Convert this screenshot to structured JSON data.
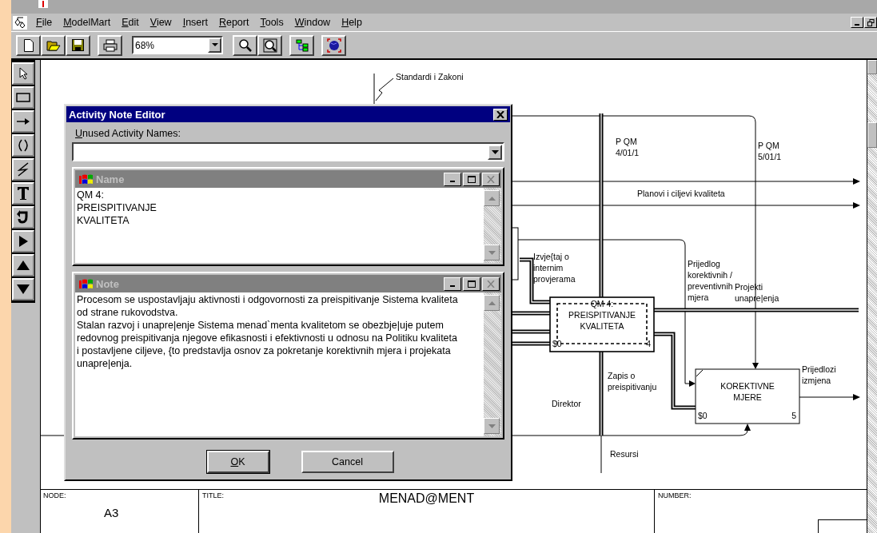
{
  "menu": [
    {
      "label": "File"
    },
    {
      "label": "ModelMart"
    },
    {
      "label": "Edit"
    },
    {
      "label": "View"
    },
    {
      "label": "Insert"
    },
    {
      "label": "Report"
    },
    {
      "label": "Tools"
    },
    {
      "label": "Window"
    },
    {
      "label": "Help"
    }
  ],
  "toolbar": {
    "zoom": "68%"
  },
  "diagram": {
    "labels": [
      {
        "lines": [
          "Standardi i Zakoni"
        ]
      },
      {
        "lines": [
          "P QM",
          "4/01/1"
        ]
      },
      {
        "lines": [
          "P QM",
          "5/01/1"
        ]
      },
      {
        "lines": [
          "Planovi i ciljevi kvaliteta"
        ]
      },
      {
        "lines": [
          "Izvje{taj o",
          "internim",
          "provjerama"
        ]
      },
      {
        "lines": [
          "Prijedlog",
          "korektivnih /",
          "preventivnih",
          "mjera"
        ]
      },
      {
        "lines": [
          "Projekti",
          "unapre|enja"
        ]
      },
      {
        "lines": [
          "Zapis o",
          "preispitivanju"
        ]
      },
      {
        "lines": [
          "Direktor"
        ]
      },
      {
        "lines": [
          "Resursi"
        ]
      },
      {
        "lines": [
          "Prijedlozi",
          "izmjena"
        ]
      }
    ],
    "boxes": [
      {
        "lines": [
          "QM 4:",
          "PREISPITIVANJE",
          "KVALITETA"
        ],
        "cost": "$0",
        "number": "4",
        "selected": true
      },
      {
        "lines": [
          "KOREKTIVNE",
          "MJERE"
        ],
        "cost": "$0",
        "number": "5",
        "selected": false
      }
    ]
  },
  "title_block": {
    "node_label": "NODE:",
    "node": "A3",
    "title_label": "TITLE:",
    "title": "MENAD@MENT",
    "number_label": "NUMBER:"
  },
  "dialog": {
    "title": "Activity Note Editor",
    "unused_label": "Unused Activity Names:",
    "name_pane": {
      "title": "Name",
      "text": "QM 4:\nPREISPITIVANJE\nKVALITETA"
    },
    "note_pane": {
      "title": "Note",
      "paragraphs": [
        "Procesom se uspostavljaju aktivnosti i odgovornosti za preispitivanje Sistema kvaliteta od strane rukovodstva.",
        "Stalan razvoj i unapre|enje Sistema menad`menta kvalitetom se obezbje|uje putem redovnog preispitivanja njegove efikasnosti i efektivnosti u odnosu na Politiku kvaliteta i postavljene ciljeve, {to predstavlja osnov za pokretanje korektivnih mjera i projekata unapre|enja."
      ]
    },
    "buttons": [
      {
        "label": "OK",
        "default": true
      },
      {
        "label": "Cancel",
        "default": false
      }
    ]
  }
}
